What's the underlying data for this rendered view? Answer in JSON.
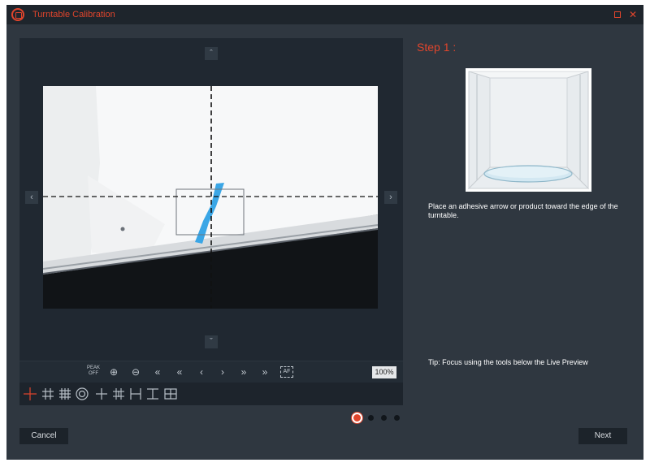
{
  "window": {
    "title": "Turntable Calibration",
    "close_glyph": "✕",
    "accent_color": "#e0452c"
  },
  "navigation": {
    "up": "ˆ",
    "down": "ˇ",
    "left": "‹",
    "right": "›"
  },
  "zoom_toolbar": {
    "peak_label": "PEAK OFF",
    "zoom_in": "⊕",
    "zoom_out": "⊖",
    "focus_far_fast": "«",
    "focus_far": "‹",
    "focus_near": "‹",
    "focus_near_2": "›",
    "focus_near_fast": "›",
    "focus_near_fastest": "»",
    "zoom_level": "100%",
    "autofocus": "AF"
  },
  "overlay_tools": [
    "crosshair-icon",
    "grid-3x3-icon",
    "grid-4x4-icon",
    "target-circle-icon",
    "crosshair-small-icon",
    "grid-dense-icon",
    "horizontal-guides-icon",
    "vertical-guides-icon",
    "box-grid-icon"
  ],
  "pager": {
    "count": 4,
    "active_index": 0
  },
  "step": {
    "title": "Step 1 :",
    "instruction": "Place an adhesive arrow or product toward the edge of the turntable.",
    "tip": "Tip:  Focus using the tools below the Live Preview"
  },
  "buttons": {
    "cancel": "Cancel",
    "next": "Next"
  }
}
